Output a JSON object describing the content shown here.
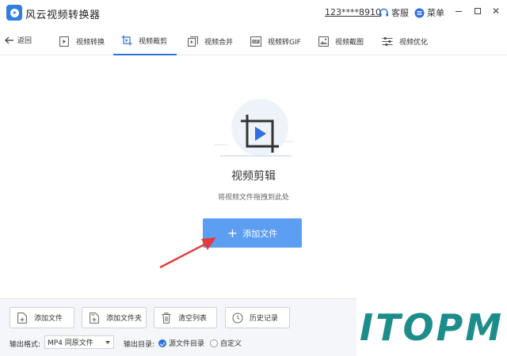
{
  "app": {
    "title": "风云视频转换器",
    "user_id": "123****8910",
    "service_label": "客服",
    "menu_label": "菜单"
  },
  "nav": {
    "back_label": "返回",
    "tabs": [
      {
        "label": "视频转换",
        "icon": "video-convert-icon",
        "active": false
      },
      {
        "label": "视频裁剪",
        "icon": "crop-icon",
        "active": true
      },
      {
        "label": "视频合并",
        "icon": "merge-icon",
        "active": false
      },
      {
        "label": "视频转GIF",
        "icon": "gif-icon",
        "active": false
      },
      {
        "label": "视频截图",
        "icon": "screenshot-icon",
        "active": false
      },
      {
        "label": "视频优化",
        "icon": "optimize-icon",
        "active": false
      }
    ]
  },
  "main": {
    "title": "视频剪辑",
    "hint": "将视频文件拖拽到此处",
    "add_button_label": "添加文件"
  },
  "bottom": {
    "buttons": [
      {
        "label": "添加文件",
        "icon": "add-file-icon"
      },
      {
        "label": "添加文件夹",
        "icon": "add-folder-icon"
      },
      {
        "label": "清空列表",
        "icon": "trash-icon"
      },
      {
        "label": "历史记录",
        "icon": "history-icon"
      }
    ],
    "format_label": "输出格式:",
    "format_value": "MP4 同原文件",
    "output_dir_label": "输出目录:",
    "output_options": [
      {
        "label": "源文件目录",
        "selected": true
      },
      {
        "label": "自定义",
        "selected": false
      }
    ]
  },
  "watermark": {
    "text": "ITOPM"
  },
  "colors": {
    "accent": "#2f6fe0",
    "button": "#5b9ef2",
    "annotation_arrow": "#e53a3a",
    "watermark": "#1d8d8b"
  }
}
